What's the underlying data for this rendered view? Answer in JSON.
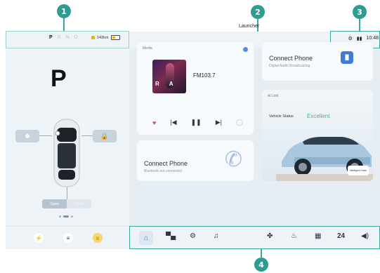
{
  "callouts": [
    "1",
    "2",
    "3",
    "4"
  ],
  "gear_selector": {
    "gears": [
      "P",
      "R",
      "N",
      "D"
    ],
    "active": "P",
    "range": "142km",
    "current_gear": "P"
  },
  "vehicle_controls": {
    "left_button_icon": "fan-icon",
    "right_button_icon": "lock-icon",
    "toggle_labels": [
      "Open",
      "Close"
    ]
  },
  "status_bar": {
    "time": "10:48",
    "icons": [
      "connectivity-icon",
      "signal-icon"
    ]
  },
  "launcher": {
    "title": "Launcher"
  },
  "media": {
    "label": "Media",
    "station": "FM103.7",
    "album_text": "R A",
    "controls": [
      "heart-icon",
      "previous-icon",
      "pause-icon",
      "next-icon",
      "loop-icon"
    ]
  },
  "connect_phone_bluetooth": {
    "title": "Connect Phone",
    "subtitle": "Bluetooth not connected"
  },
  "connect_phone_dab": {
    "title": "Connect Phone",
    "subtitle": "Digital Audio Broadcasting"
  },
  "ai_card": {
    "label": "AI Unit",
    "status_label": "Vehicle Status",
    "status_value": "Excellent",
    "badge": "Intelligent Voice"
  },
  "bottom_dock": {
    "items": [
      "home-icon",
      "car-icon",
      "settings-icon",
      "music-icon",
      "fan-icon",
      "seat-heat-icon",
      "defrost-icon"
    ],
    "temperature": "24",
    "volume_icon": "volume-icon"
  },
  "left_dock": {
    "items": [
      "power-icon",
      "media-icon",
      "bluetooth-icon"
    ]
  },
  "colors": {
    "callout": "#2f9c8f",
    "accent": "#3b7bd6",
    "status_good": "#3bbf8a"
  }
}
